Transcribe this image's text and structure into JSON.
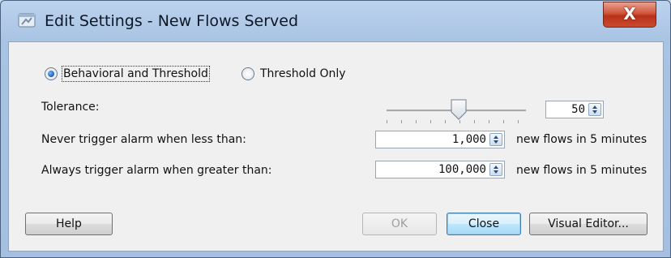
{
  "window": {
    "title": "Edit Settings - New Flows Served",
    "close_glyph": "X",
    "icon": "settings-window-icon"
  },
  "mode": {
    "options": [
      {
        "label": "Behavioral and Threshold",
        "selected": true
      },
      {
        "label": "Threshold Only",
        "selected": false
      }
    ]
  },
  "tolerance": {
    "label": "Tolerance:",
    "value": "50",
    "slider_level": 0.5
  },
  "never_trigger": {
    "label": "Never trigger alarm when less than:",
    "value": "1,000",
    "unit": "new flows in 5 minutes"
  },
  "always_trigger": {
    "label": "Always trigger alarm when greater than:",
    "value": "100,000",
    "unit": "new flows in 5 minutes"
  },
  "buttons": {
    "help": "Help",
    "ok": "OK",
    "close": "Close",
    "visual_editor": "Visual Editor..."
  },
  "colors": {
    "title_bar": "#a9c3e3",
    "close_button": "#c94a2f",
    "default_button": "#3c7fb1",
    "selected_radio": "#1a5ec0"
  }
}
